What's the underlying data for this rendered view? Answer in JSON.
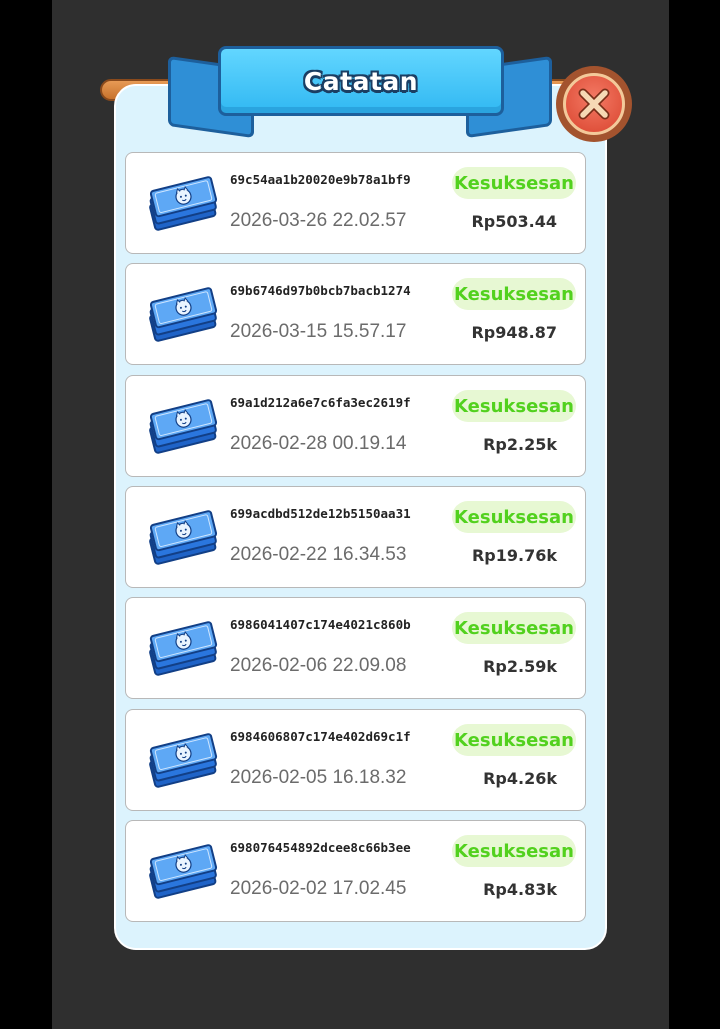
{
  "dialog": {
    "title": "Catatan",
    "close_icon": "close-x-icon"
  },
  "records": [
    {
      "id": "69c54aa1b20020e9b78a1bf9",
      "date": "2026-03-26 22.02.57",
      "status": "Kesuksesan",
      "amount": "Rp503.44",
      "icon": "banknote-stack-icon"
    },
    {
      "id": "69b6746d97b0bcb7bacb1274",
      "date": "2026-03-15 15.57.17",
      "status": "Kesuksesan",
      "amount": "Rp948.87",
      "icon": "banknote-stack-icon"
    },
    {
      "id": "69a1d212a6e7c6fa3ec2619f",
      "date": "2026-02-28 00.19.14",
      "status": "Kesuksesan",
      "amount": "Rp2.25k",
      "icon": "banknote-stack-icon"
    },
    {
      "id": "699acdbd512de12b5150aa31",
      "date": "2026-02-22 16.34.53",
      "status": "Kesuksesan",
      "amount": "Rp19.76k",
      "icon": "banknote-stack-icon"
    },
    {
      "id": "6986041407c174e4021c860b",
      "date": "2026-02-06 22.09.08",
      "status": "Kesuksesan",
      "amount": "Rp2.59k",
      "icon": "banknote-stack-icon"
    },
    {
      "id": "6984606807c174e402d69c1f",
      "date": "2026-02-05 16.18.32",
      "status": "Kesuksesan",
      "amount": "Rp4.26k",
      "icon": "banknote-stack-icon"
    },
    {
      "id": "698076454892dcee8c66b3ee",
      "date": "2026-02-02 17.02.45",
      "status": "Kesuksesan",
      "amount": "Rp4.83k",
      "icon": "banknote-stack-icon"
    }
  ],
  "colors": {
    "status_text": "#52d11e",
    "status_bg": "#e7f8d3",
    "panel_bg": "#dcf3fd",
    "ribbon": "#31b8f2",
    "close_button": "#d9442e"
  }
}
